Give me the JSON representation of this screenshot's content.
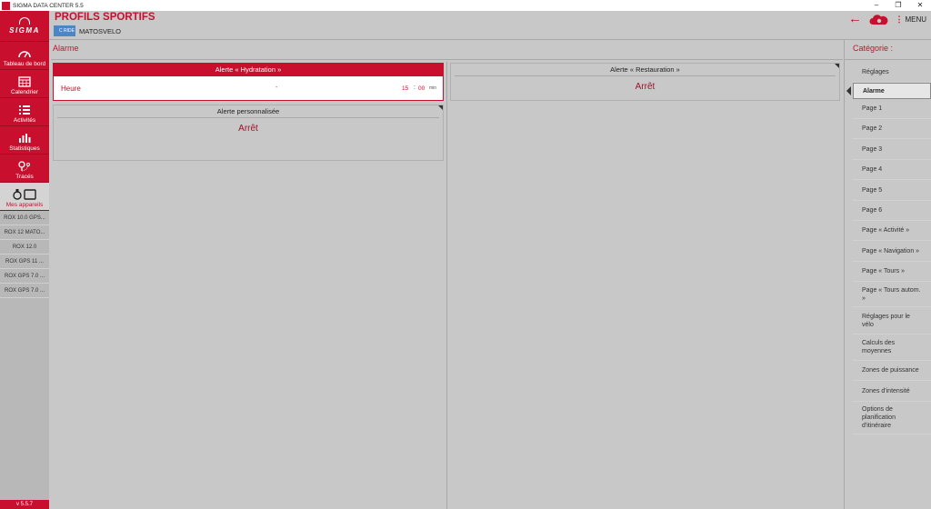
{
  "window": {
    "title": "SIGMA DATA CENTER 5.5",
    "controls": [
      "–",
      "❐",
      "✕"
    ]
  },
  "sidebar": {
    "logo": "SIGMA",
    "nav": [
      {
        "label": "Tableau de bord",
        "icon": "speedometer-icon"
      },
      {
        "label": "Calendrier",
        "icon": "calendar-icon"
      },
      {
        "label": "Activités",
        "icon": "list-icon"
      },
      {
        "label": "Statistiques",
        "icon": "bar-chart-icon"
      },
      {
        "label": "Tracés",
        "icon": "route-icon"
      },
      {
        "label": "Mes appareils",
        "icon": "devices-icon"
      }
    ],
    "devices": [
      "ROX 10.0 GPS...",
      "ROX 12 MATO...",
      "ROX 12.0",
      "ROX GPS 11 ...",
      "ROX GPS 7.0 ...",
      "ROX GPS 7.0 ..."
    ],
    "version": "v 5.5.7"
  },
  "header": {
    "title": "PROFILS SPORTIFS",
    "profile_badge": "C RIDE",
    "profile_name": "MATOSVELO",
    "menu_label": "MENU",
    "menu_dots": "⋮",
    "back_arrow": "←"
  },
  "main": {
    "section_title": "Alarme",
    "cards": {
      "hydration": {
        "title": "Alerte « Hydratation »",
        "row_label": "Heure",
        "row_dash": "-",
        "hours": "15",
        "colon": ":",
        "minutes": "00",
        "unit": "min"
      },
      "restauration": {
        "title": "Alerte « Restauration »",
        "value": "Arrêt"
      },
      "custom": {
        "title": "Alerte personnalisée",
        "value": "Arrêt"
      }
    }
  },
  "categories": {
    "title": "Catégorie :",
    "items": [
      "Réglages",
      "Alarme",
      "Page 1",
      "Page 2",
      "Page 3",
      "Page 4",
      "Page 5",
      "Page 6",
      "Page « Activité »",
      "Page « Navigation »",
      "Page « Tours »",
      "Page « Tours autom. »",
      "Réglages pour le vélo",
      "Calculs des moyennes",
      "Zones de puissance",
      "Zones d'intensité",
      "Options de planification d'itinéraire"
    ],
    "active_index": 1
  },
  "colors": {
    "accent": "#c8102e",
    "background": "#c8c8c8",
    "badge": "#4d86c7"
  }
}
